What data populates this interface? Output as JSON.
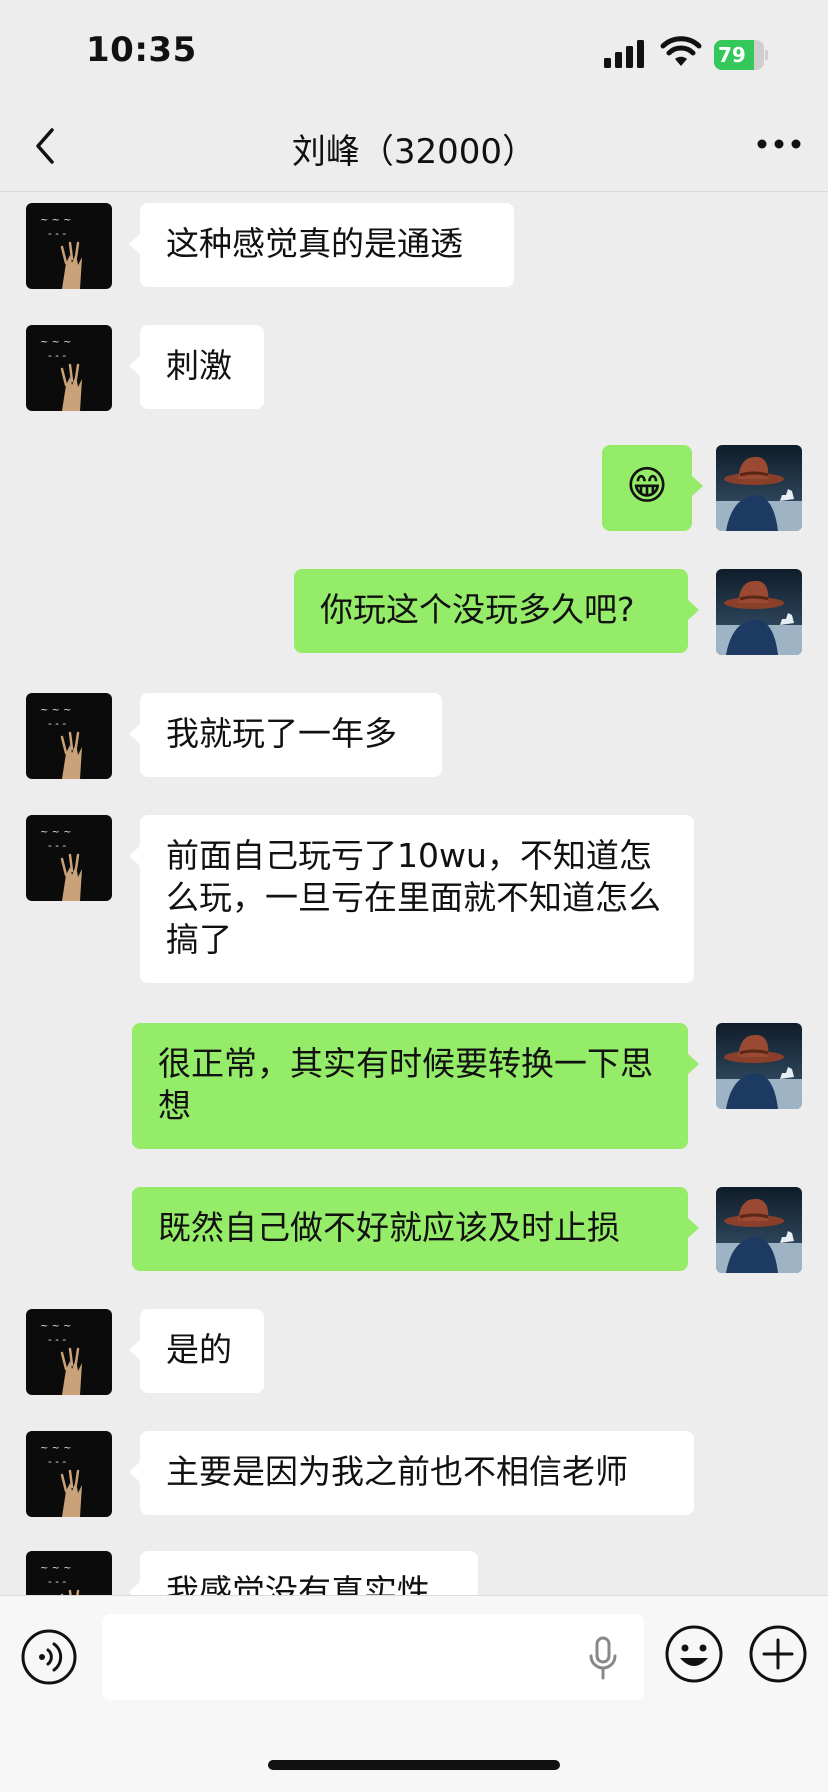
{
  "status_bar": {
    "time": "10:35",
    "battery": "79",
    "battery_level": 0.79,
    "icons": [
      "signal-icon",
      "wifi-icon",
      "battery-icon"
    ]
  },
  "nav": {
    "title": "刘峰（32000）",
    "back_icon": "chevron-left-icon",
    "more_icon": "more-dots-icon"
  },
  "chat": {
    "messages": [
      {
        "side": "in",
        "text": "这种感觉真的是通透"
      },
      {
        "side": "in",
        "text": "刺激"
      },
      {
        "side": "out",
        "text": "😁"
      },
      {
        "side": "out",
        "text": "你玩这个没玩多久吧?"
      },
      {
        "side": "in",
        "text": "我就玩了一年多"
      },
      {
        "side": "in",
        "text": "前面自己玩亏了10wu，不知道怎么玩，一旦亏在里面就不知道怎么搞了"
      },
      {
        "side": "out",
        "text": "很正常，其实有时候要转换一下思想"
      },
      {
        "side": "out",
        "text": "既然自己做不好就应该及时止损"
      },
      {
        "side": "in",
        "text": "是的"
      },
      {
        "side": "in",
        "text": "主要是因为我之前也不相信老师"
      },
      {
        "side": "in",
        "text": "我感觉没有真实性"
      }
    ]
  },
  "input_bar": {
    "placeholder": "",
    "icons": [
      "voice-icon",
      "mic-icon",
      "emoji-icon",
      "add-icon"
    ]
  },
  "colors": {
    "background": "#ededed",
    "incoming_bubble": "#ffffff",
    "outgoing_bubble": "#95ec69",
    "battery_green": "#34c759"
  }
}
